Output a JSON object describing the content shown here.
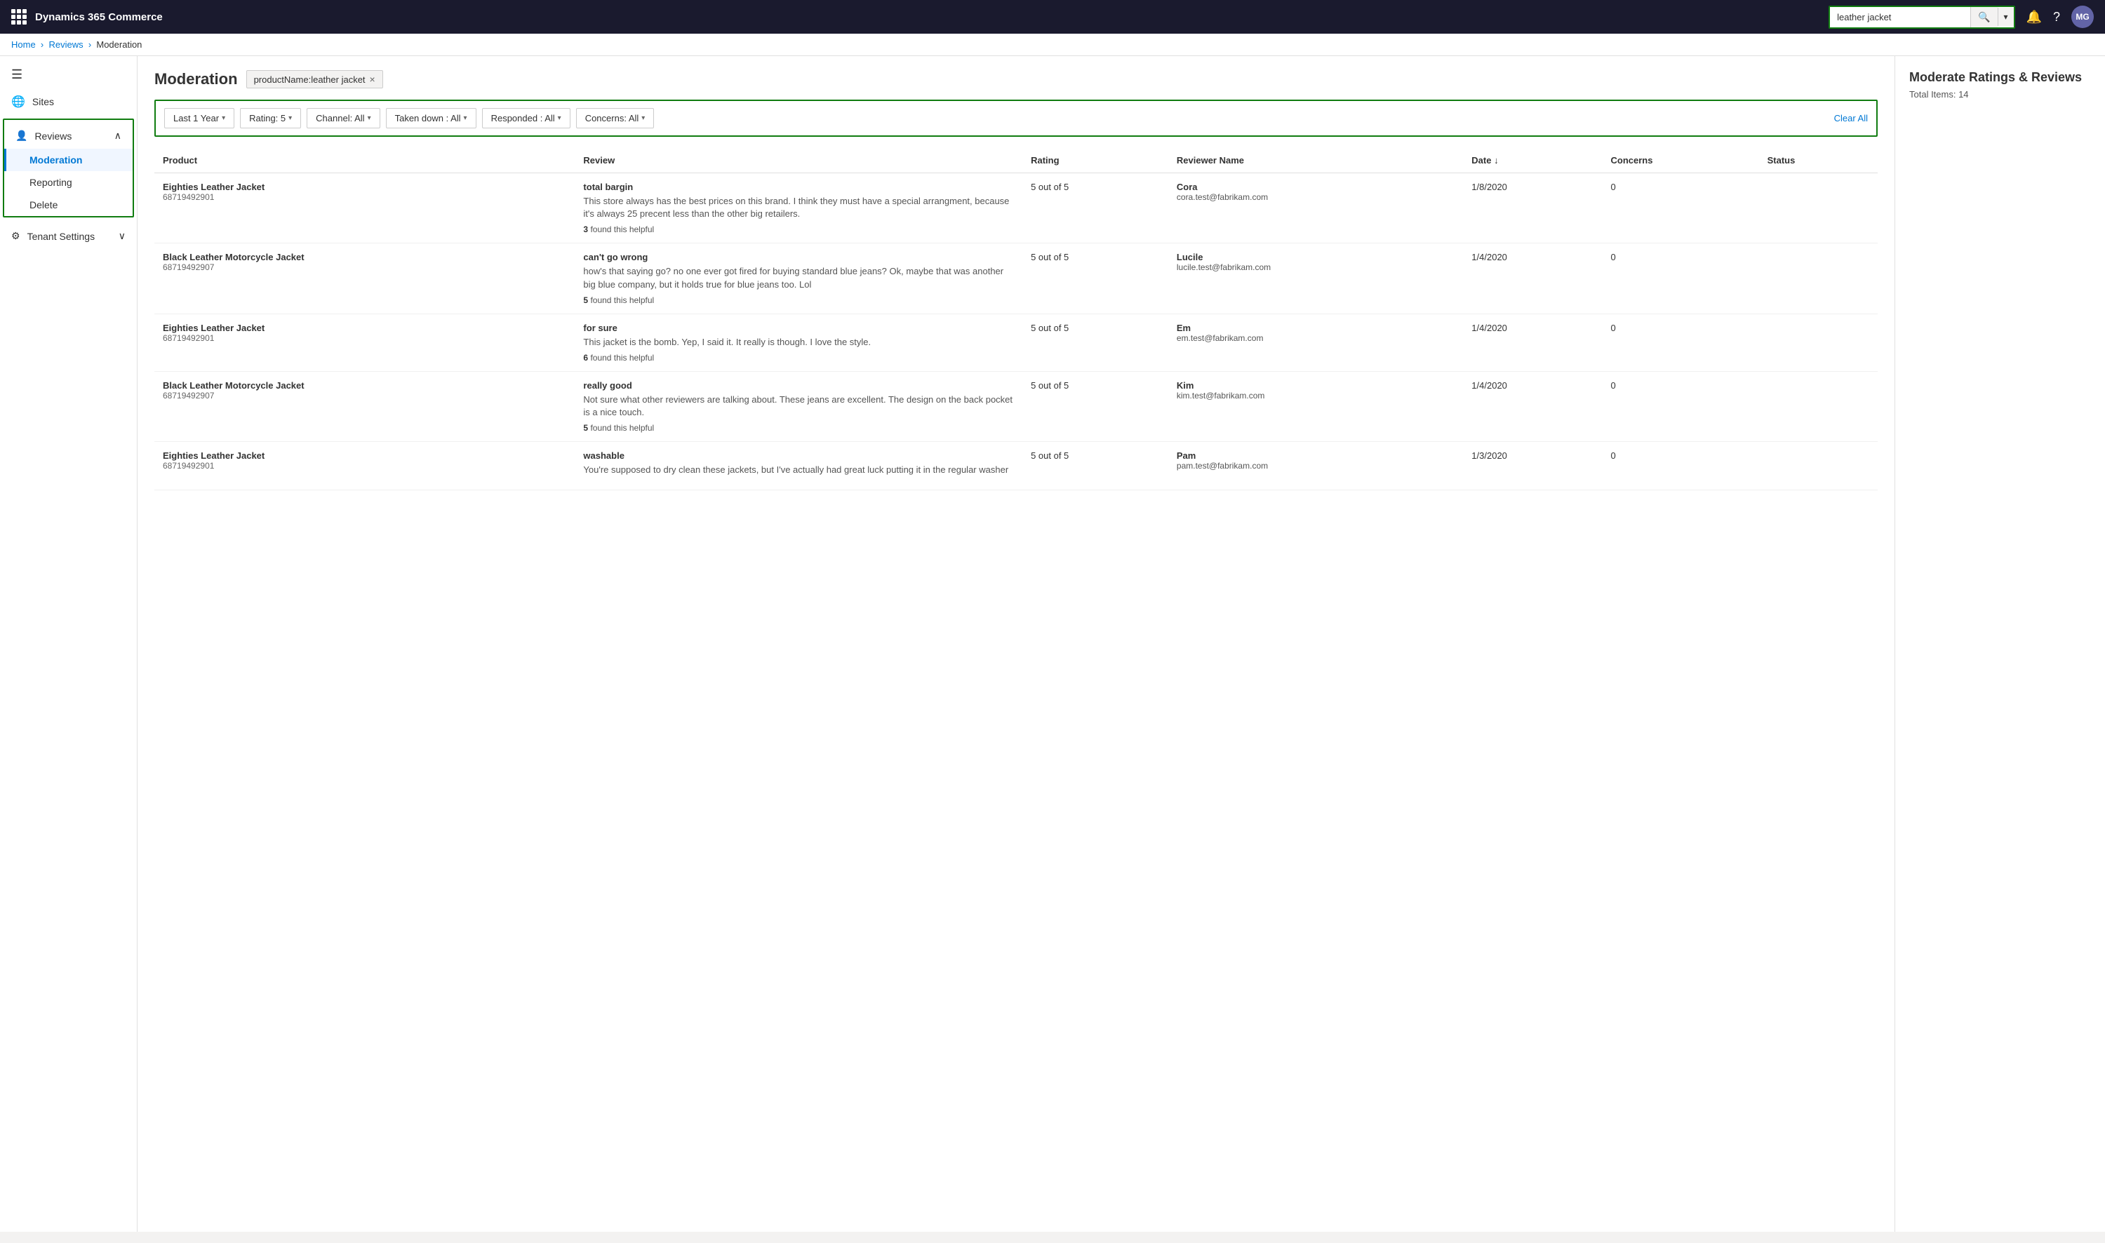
{
  "app": {
    "title": "Dynamics 365 Commerce",
    "avatar": "MG"
  },
  "search": {
    "value": "leather jacket",
    "placeholder": "leather jacket"
  },
  "breadcrumb": {
    "items": [
      "Home",
      "Reviews",
      "Moderation"
    ]
  },
  "sidebar": {
    "hamburger_icon": "≡",
    "sites_label": "Sites",
    "reviews_label": "Reviews",
    "reviews_chevron": "∧",
    "sub_items": [
      "Moderation",
      "Reporting",
      "Delete"
    ],
    "tenant_label": "Tenant Settings",
    "tenant_chevron": "∨"
  },
  "page": {
    "title": "Moderation",
    "filter_tag": "productName:leather jacket",
    "clear_tag": "×"
  },
  "filters": {
    "time": "Last 1 Year",
    "rating": "Rating: 5",
    "channel": "Channel: All",
    "taken_down": "Taken down : All",
    "responded": "Responded : All",
    "concerns": "Concerns: All",
    "clear_all": "Clear All"
  },
  "table": {
    "columns": [
      "Product",
      "Review",
      "Rating",
      "Reviewer Name",
      "Date ↓",
      "Concerns",
      "Status"
    ],
    "rows": [
      {
        "product_name": "Eighties Leather Jacket",
        "product_id": "68719492901",
        "review_title": "total bargin",
        "review_body": "This store always has the best prices on this brand. I think they must have a special arrangment, because it's always 25 precent less than the other big retailers.",
        "review_helpful": "3",
        "rating": "5 out of 5",
        "reviewer_name": "Cora",
        "reviewer_email": "cora.test@fabrikam.com",
        "date": "1/8/2020",
        "concerns": "0",
        "status": ""
      },
      {
        "product_name": "Black Leather Motorcycle Jacket",
        "product_id": "68719492907",
        "review_title": "can't go wrong",
        "review_body": "how's that saying go? no one ever got fired for buying standard blue jeans? Ok, maybe that was another big blue company, but it holds true for blue jeans too. Lol",
        "review_helpful": "5",
        "rating": "5 out of 5",
        "reviewer_name": "Lucile",
        "reviewer_email": "lucile.test@fabrikam.com",
        "date": "1/4/2020",
        "concerns": "0",
        "status": ""
      },
      {
        "product_name": "Eighties Leather Jacket",
        "product_id": "68719492901",
        "review_title": "for sure",
        "review_body": "This jacket is the bomb. Yep, I said it. It really is though. I love the style.",
        "review_helpful": "6",
        "rating": "5 out of 5",
        "reviewer_name": "Em",
        "reviewer_email": "em.test@fabrikam.com",
        "date": "1/4/2020",
        "concerns": "0",
        "status": ""
      },
      {
        "product_name": "Black Leather Motorcycle Jacket",
        "product_id": "68719492907",
        "review_title": "really good",
        "review_body": "Not sure what other reviewers are talking about. These jeans are excellent. The design on the back pocket is a nice touch.",
        "review_helpful": "5",
        "rating": "5 out of 5",
        "reviewer_name": "Kim",
        "reviewer_email": "kim.test@fabrikam.com",
        "date": "1/4/2020",
        "concerns": "0",
        "status": ""
      },
      {
        "product_name": "Eighties Leather Jacket",
        "product_id": "68719492901",
        "review_title": "washable",
        "review_body": "You're supposed to dry clean these jackets, but I've actually had great luck putting it in the regular washer",
        "review_helpful": "",
        "rating": "5 out of 5",
        "reviewer_name": "Pam",
        "reviewer_email": "pam.test@fabrikam.com",
        "date": "1/3/2020",
        "concerns": "0",
        "status": ""
      }
    ]
  },
  "right_panel": {
    "title": "Moderate Ratings & Reviews",
    "total_label": "Total Items: 14"
  }
}
